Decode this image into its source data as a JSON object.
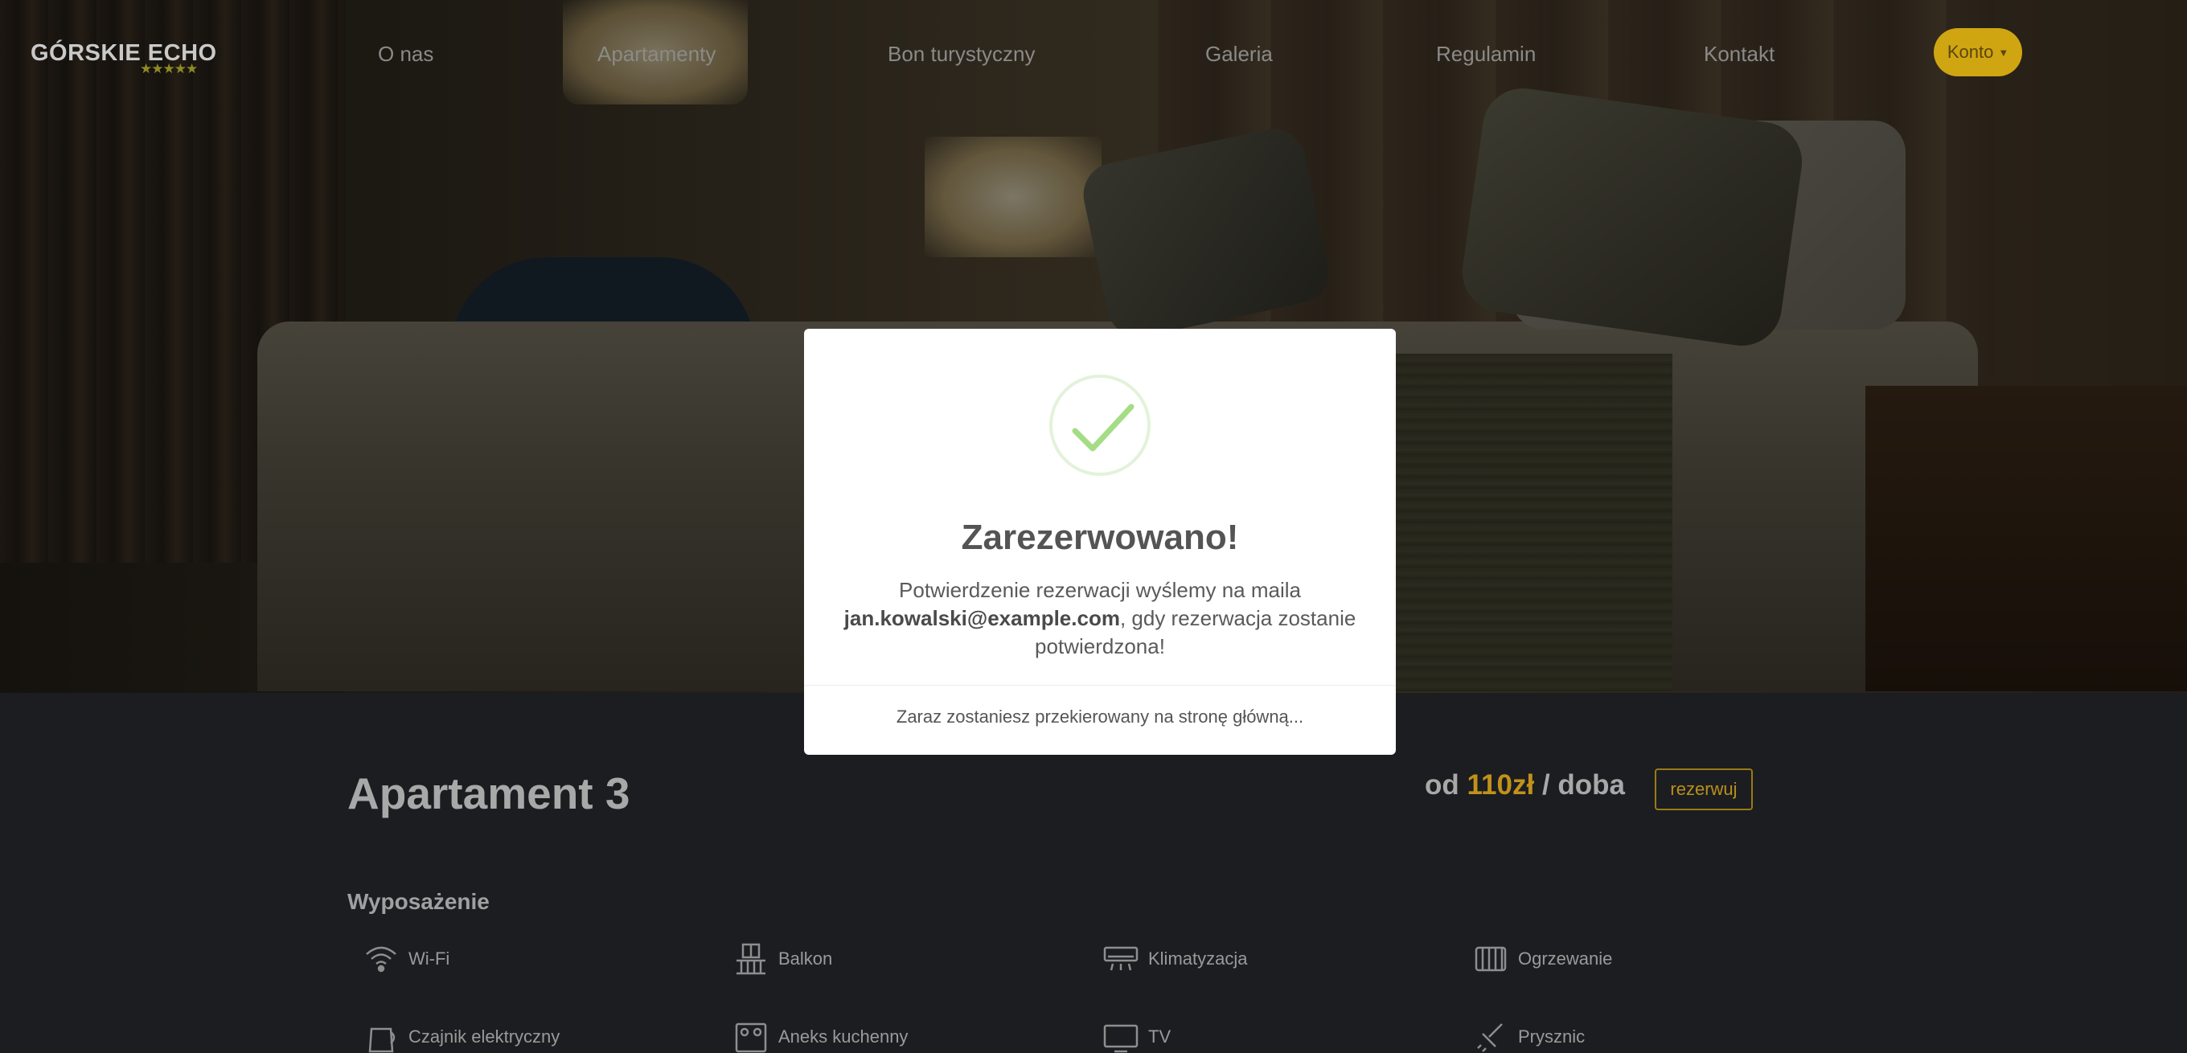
{
  "nav": {
    "brand": "GÓRSKIE ECHO",
    "brand_stars": "★★★★★",
    "links": [
      "O nas",
      "Apartamenty",
      "Bon turystyczny",
      "Galeria",
      "Regulamin",
      "Kontakt"
    ],
    "account": "Konto"
  },
  "apartment": {
    "title": "Apartament 3",
    "price_prefix": "od",
    "price_amount": "110zł",
    "price_suffix": "/ doba",
    "reserve_label": "rezerwuj",
    "equipment_heading": "Wyposażenie",
    "amenities": [
      "Wi-Fi",
      "Balkon",
      "Klimatyzacja",
      "Ogrzewanie",
      "Czajnik elektryczny",
      "Aneks kuchenny",
      "TV",
      "Prysznic"
    ]
  },
  "modal": {
    "title": "Zarezerwowano!",
    "body_before": "Potwierdzenie rezerwacji wyślemy na maila",
    "email": "jan.kowalski@example.com",
    "body_after": ", gdy rezerwacja zostanie potwierdzona!",
    "footer": "Zaraz zostaniesz przekierowany na stronę główną..."
  },
  "colors": {
    "accent": "#cfa512",
    "price": "#c0921a",
    "success_check": "#a5dc86"
  }
}
